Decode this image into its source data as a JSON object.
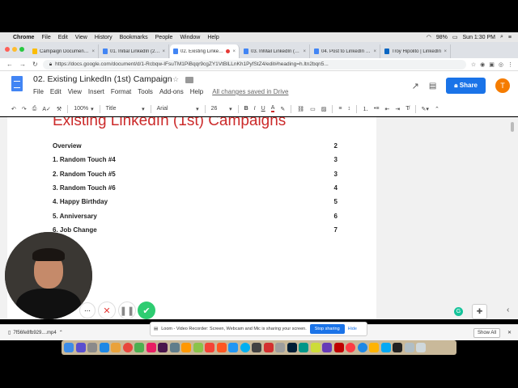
{
  "menubar": {
    "app": "Chrome",
    "items": [
      "File",
      "Edit",
      "View",
      "History",
      "Bookmarks",
      "People",
      "Window",
      "Help"
    ],
    "battery": "98%",
    "clock": "Sun 1:30 PM"
  },
  "tabs": [
    {
      "title": "Campaign Documents - G",
      "icon": "google-drive-icon",
      "active": false
    },
    {
      "title": "01. Initial LinkedIn (2nd t",
      "icon": "google-docs-icon",
      "active": false
    },
    {
      "title": "02. Existing LinkedIn",
      "icon": "google-docs-icon",
      "active": true
    },
    {
      "title": "03. InMail LinkedIn (3rd)",
      "icon": "google-docs-icon",
      "active": false
    },
    {
      "title": "04. Post to LinkedIn Med",
      "icon": "google-docs-icon",
      "active": false
    },
    {
      "title": "Troy Hipolito | LinkedIn",
      "icon": "linkedin-icon",
      "active": false
    }
  ],
  "address": {
    "url": "https://docs.google.com/document/d/1-Rcbqw-IFsuTM1PiBqqr9cgZY1VtBlLLnKh1PyfStZ4/edit#heading=h.ltn2bqn5..."
  },
  "doc": {
    "title": "02. Existing LinkedIn (1st) Campaign",
    "menu": [
      "File",
      "Edit",
      "View",
      "Insert",
      "Format",
      "Tools",
      "Add-ons",
      "Help"
    ],
    "saved_status": "All changes saved in Drive",
    "share_label": "Share",
    "avatar_letter": "T"
  },
  "toolbar": {
    "zoom": "100%",
    "style": "Title",
    "font": "Arial",
    "size": "26"
  },
  "content": {
    "heading": "Existing LinkedIn (1st) Campaigns",
    "toc": [
      {
        "label": "Overview",
        "page": "2"
      },
      {
        "label": "1.  Random Touch #4",
        "page": "3"
      },
      {
        "label": "2.  Random Touch #5",
        "page": "3"
      },
      {
        "label": "3.  Random Touch #6",
        "page": "4"
      },
      {
        "label": "4. Happy Birthday",
        "page": "5"
      },
      {
        "label": "5. Anniversary",
        "page": "6"
      },
      {
        "label": "6. Job Change",
        "page": "7"
      }
    ]
  },
  "loom": {
    "message": "Loom - Video Recorder: Screen, Webcam and Mic is sharing your screen.",
    "stop_label": "Stop sharing",
    "hide_label": "Hide"
  },
  "downloads": {
    "file": "7f56fe8fb929....mp4",
    "show_all": "Show All"
  },
  "colors": {
    "accent": "#1a73e8",
    "heading": "#cc2b2b",
    "record": "#e53935",
    "loom_check": "#2ecc71"
  }
}
